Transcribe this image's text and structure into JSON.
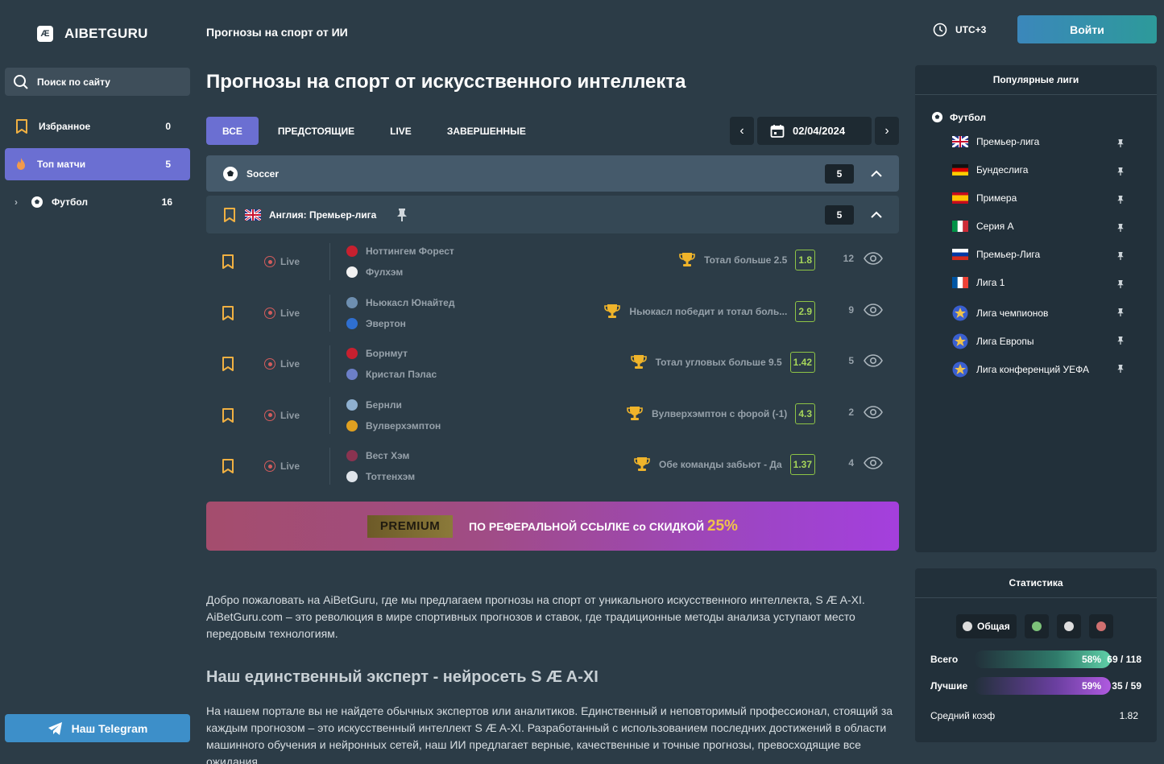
{
  "brand": {
    "mark": "Æ",
    "name": "AIBETGURU"
  },
  "header": {
    "title": "Прогнозы на спорт от ИИ",
    "utc": "UTC+3",
    "login": "Войти"
  },
  "sidebar": {
    "search_placeholder": "Поиск по сайту",
    "items": [
      {
        "label": "Избранное",
        "count": "0"
      },
      {
        "label": "Топ матчи",
        "count": "5"
      },
      {
        "label": "Футбол",
        "count": "16"
      }
    ],
    "telegram": "Наш Telegram"
  },
  "main": {
    "title": "Прогнозы на спорт от искусственного интеллекта",
    "tabs": [
      "ВСЕ",
      "ПРЕДСТОЯЩИЕ",
      "LIVE",
      "ЗАВЕРШЕННЫЕ"
    ],
    "date": "02/04/2024",
    "sport": {
      "name": "Soccer",
      "count": "5"
    },
    "league": {
      "name": "Англия: Премьер-лига",
      "count": "5"
    },
    "matches": [
      {
        "status": "Live",
        "home": "Ноттингем Форест",
        "away": "Фулхэм",
        "prediction": "Тотал больше 2.5",
        "odd": "1.8",
        "views": "12"
      },
      {
        "status": "Live",
        "home": "Ньюкасл Юнайтед",
        "away": "Эвертон",
        "prediction": "Ньюкасл победит и тотал боль...",
        "odd": "2.9",
        "views": "9"
      },
      {
        "status": "Live",
        "home": "Борнмут",
        "away": "Кристал Пэлас",
        "prediction": "Тотал угловых больше 9.5",
        "odd": "1.42",
        "views": "5"
      },
      {
        "status": "Live",
        "home": "Бернли",
        "away": "Вулверхэмптон",
        "prediction": "Вулверхэмптон с форой (-1)",
        "odd": "4.3",
        "views": "2"
      },
      {
        "status": "Live",
        "home": "Вест Хэм",
        "away": "Тоттенхэм",
        "prediction": "Обе команды забьют - Да",
        "odd": "1.37",
        "views": "4"
      }
    ],
    "banner": {
      "badge": "PREMIUM",
      "text": "ПО РЕФЕРАЛЬНОЙ ССЫЛКЕ со СКИДКОЙ",
      "percent": "25%"
    },
    "intro": "Добро пожаловать на AiBetGuru, где мы предлагаем прогнозы на спорт от уникального искусственного интеллекта, S Æ A-XI. AiBetGuru.com – это революция в мире спортивных прогнозов и ставок, где традиционные методы анализа уступают место передовым технологиям.",
    "expert_title": "Наш единственный эксперт - нейросеть S Æ A-XI",
    "expert_text": "На нашем портале вы не найдете обычных экспертов или аналитиков. Единственный и неповторимый профессионал, стоящий за каждым прогнозом – это искусственный интеллект S Æ A-XI. Разработанный с использованием последних достижений в области машинного обучения и нейронных сетей, наш ИИ предлагает верные, качественные и точные прогнозы, превосходящие все ожидания."
  },
  "popular": {
    "title": "Популярные лиги",
    "category": "Футбол",
    "leagues": [
      "Премьер-лига",
      "Бундеслига",
      "Примера",
      "Серия А",
      "Премьер-Лига",
      "Лига 1",
      "Лига чемпионов",
      "Лига Европы",
      "Лига конференций УЕФА"
    ]
  },
  "stats": {
    "title": "Статистика",
    "tab_all": "Общая",
    "rows": [
      {
        "label": "Всего",
        "percent": "58%",
        "value": "69 / 118"
      },
      {
        "label": "Лучшие",
        "percent": "59%",
        "value": "35 / 59"
      },
      {
        "label": "Средний коэф",
        "value": "1.82"
      }
    ]
  },
  "colors": {
    "accent": "#6b6fd2",
    "odd": "#8ec446",
    "live": "#d35c5c",
    "gold": "#f0c24a"
  }
}
